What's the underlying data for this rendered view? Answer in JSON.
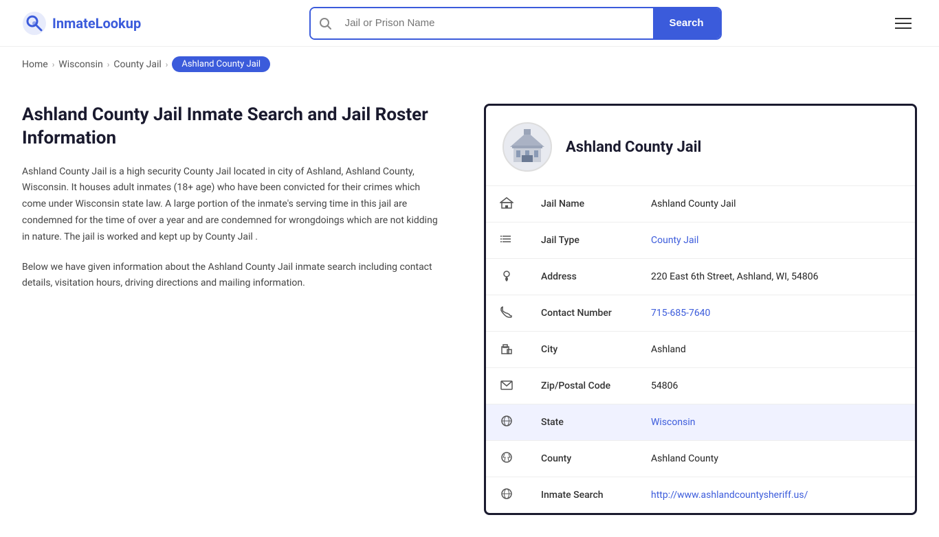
{
  "header": {
    "logo_text_part1": "Inmate",
    "logo_text_part2": "Lookup",
    "search_placeholder": "Jail or Prison Name",
    "search_button_label": "Search"
  },
  "breadcrumb": {
    "home": "Home",
    "state": "Wisconsin",
    "type": "County Jail",
    "current": "Ashland County Jail"
  },
  "left": {
    "title": "Ashland County Jail Inmate Search and Jail Roster Information",
    "description": "Ashland County Jail is a high security County Jail located in city of Ashland, Ashland County, Wisconsin. It houses adult inmates (18+ age) who have been convicted for their crimes which come under Wisconsin state law. A large portion of the inmate's serving time in this jail are condemned for the time of over a year and are condemned for wrongdoings which are not kidding in nature. The jail is worked and kept up by County Jail .",
    "description2": "Below we have given information about the Ashland County Jail inmate search including contact details, visitation hours, driving directions and mailing information."
  },
  "card": {
    "title": "Ashland County Jail",
    "rows": [
      {
        "icon": "jail",
        "label": "Jail Name",
        "value": "Ashland County Jail",
        "link": null,
        "highlighted": false
      },
      {
        "icon": "list",
        "label": "Jail Type",
        "value": "County Jail",
        "link": "#",
        "highlighted": false
      },
      {
        "icon": "pin",
        "label": "Address",
        "value": "220 East 6th Street, Ashland, WI, 54806",
        "link": null,
        "highlighted": false
      },
      {
        "icon": "phone",
        "label": "Contact Number",
        "value": "715-685-7640",
        "link": "tel:715-685-7640",
        "highlighted": false
      },
      {
        "icon": "city",
        "label": "City",
        "value": "Ashland",
        "link": null,
        "highlighted": false
      },
      {
        "icon": "zip",
        "label": "Zip/Postal Code",
        "value": "54806",
        "link": null,
        "highlighted": false
      },
      {
        "icon": "globe",
        "label": "State",
        "value": "Wisconsin",
        "link": "#",
        "highlighted": true
      },
      {
        "icon": "county",
        "label": "County",
        "value": "Ashland County",
        "link": null,
        "highlighted": false
      },
      {
        "icon": "globe2",
        "label": "Inmate Search",
        "value": "http://www.ashlandcountysheriff.us/",
        "link": "http://www.ashlandcountysheriff.us/",
        "highlighted": false
      }
    ]
  },
  "icons": {
    "jail": "🏛",
    "list": "☰",
    "pin": "📍",
    "phone": "📞",
    "city": "🗺",
    "zip": "✉",
    "globe": "🌐",
    "county": "🗺",
    "globe2": "🌐"
  }
}
